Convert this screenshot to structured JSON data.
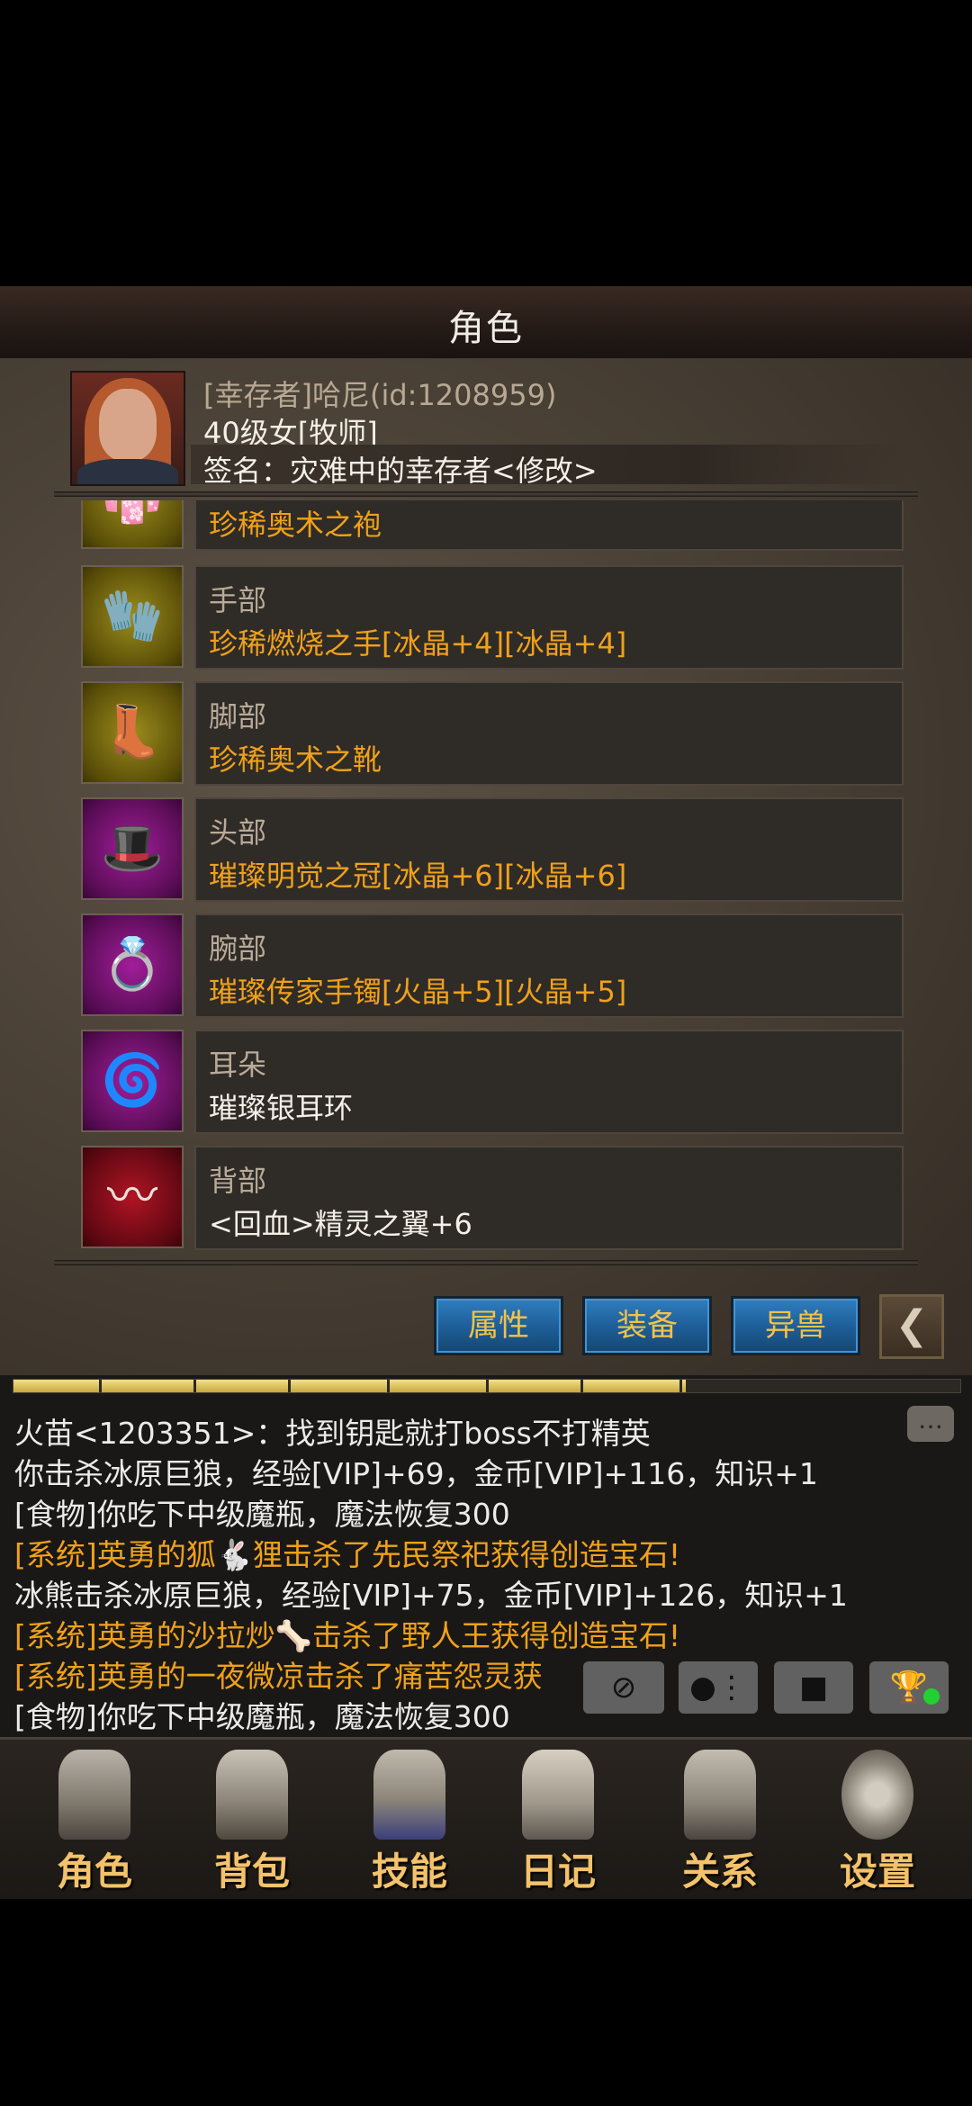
{
  "header": {
    "title": "角色"
  },
  "profile": {
    "name": "[幸存者]哈尼(id:1208959)",
    "level": "40级女[牧师]",
    "signature": "签名：灾难中的幸存者<修改>"
  },
  "equipment": [
    {
      "slot": "",
      "item": "珍稀奥术之袍",
      "item_color": "#f0a11a",
      "quality": "gold",
      "icon": "robe-icon"
    },
    {
      "slot": "手部",
      "item": "珍稀燃烧之手[冰晶+4][冰晶+4]",
      "item_color": "#f0a11a",
      "quality": "gold",
      "icon": "gauntlet-icon"
    },
    {
      "slot": "脚部",
      "item": "珍稀奥术之靴",
      "item_color": "#f0a11a",
      "quality": "gold",
      "icon": "boots-icon"
    },
    {
      "slot": "头部",
      "item": "璀璨明觉之冠[冰晶+6][冰晶+6]",
      "item_color": "#f0a11a",
      "quality": "purple",
      "icon": "wizard-hat-icon"
    },
    {
      "slot": "腕部",
      "item": "璀璨传家手镯[火晶+5][火晶+5]",
      "item_color": "#f0a11a",
      "quality": "purple",
      "icon": "bracelet-icon"
    },
    {
      "slot": "耳朵",
      "item": "璀璨银耳环",
      "item_color": "#f4f0e8",
      "quality": "purple",
      "icon": "earring-icon"
    },
    {
      "slot": "背部",
      "item": "<回血>精灵之翼+6",
      "item_color": "#f4f0e8",
      "quality": "red",
      "icon": "wings-icon"
    }
  ],
  "tabs_buttons": {
    "attributes": "属性",
    "equipment": "装备",
    "beast": "异兽"
  },
  "experience": {
    "fraction": 0.71
  },
  "chat": [
    {
      "text": "火苗<1203351>：找到钥匙就打boss不打精英",
      "color": "white"
    },
    {
      "text": "你击杀冰原巨狼，经验[VIP]+69，金币[VIP]+116，知识+1",
      "color": "white"
    },
    {
      "text": "[食物]你吃下中级魔瓶，魔法恢复300",
      "color": "white"
    },
    {
      "text": "[系统]英勇的狐🐇狸击杀了先民祭祀获得创造宝石!",
      "color": "orange"
    },
    {
      "text": "冰熊击杀冰原巨狼，经验[VIP]+75，金币[VIP]+126，知识+1",
      "color": "white"
    },
    {
      "text": "[系统]英勇的沙拉炒🦴击杀了野人王获得创造宝石!",
      "color": "orange"
    },
    {
      "text": "[系统]英勇的一夜微凉击杀了痛苦怨灵获",
      "color": "orange"
    },
    {
      "text": "[食物]你吃下中级魔瓶，魔法恢复300",
      "color": "white"
    }
  ],
  "bottom_nav": [
    {
      "label": "角色",
      "icon": "helmet-icon"
    },
    {
      "label": "背包",
      "icon": "backpack-icon"
    },
    {
      "label": "技能",
      "icon": "skill-book-icon"
    },
    {
      "label": "日记",
      "icon": "scroll-icon"
    },
    {
      "label": "关系",
      "icon": "handshake-icon"
    },
    {
      "label": "设置",
      "icon": "gear-icon"
    }
  ]
}
